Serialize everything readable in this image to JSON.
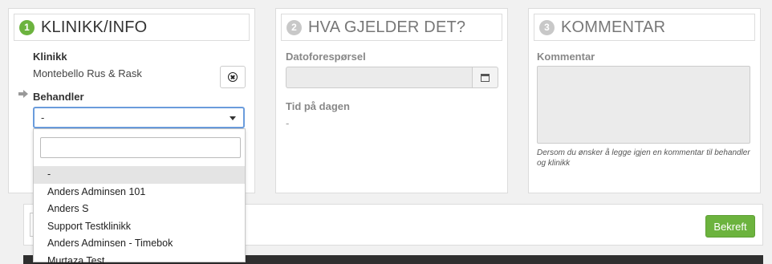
{
  "steps": [
    {
      "number": "1",
      "title": "KLINIKK/INFO"
    },
    {
      "number": "2",
      "title": "HVA GJELDER DET?"
    },
    {
      "number": "3",
      "title": "KOMMENTAR"
    }
  ],
  "clinic": {
    "label": "Klinikk",
    "value": "Montebello Rus & Rask",
    "behandler_label": "Behandler",
    "behandler_selected": "-"
  },
  "dropdown": {
    "search_value": "",
    "options": [
      "-",
      "Anders Adminsen 101",
      "Anders S",
      "Support Testklinikk",
      "Anders Adminsen - Timebok",
      "Murtaza Test"
    ]
  },
  "request": {
    "date_label": "Datoforespørsel",
    "date_value": "",
    "time_label": "Tid på dagen",
    "time_value": "-"
  },
  "comment": {
    "label": "Kommentar",
    "value": "",
    "help": "Dersom du ønsker å legge igjen en kommentar til behandler og klinikk"
  },
  "actions": {
    "confirm_label": "Bekreft"
  },
  "colors": {
    "accent_green": "#6cb33e",
    "focus_blue": "#6a9cdc",
    "inactive_step": "#c8c8c8"
  }
}
